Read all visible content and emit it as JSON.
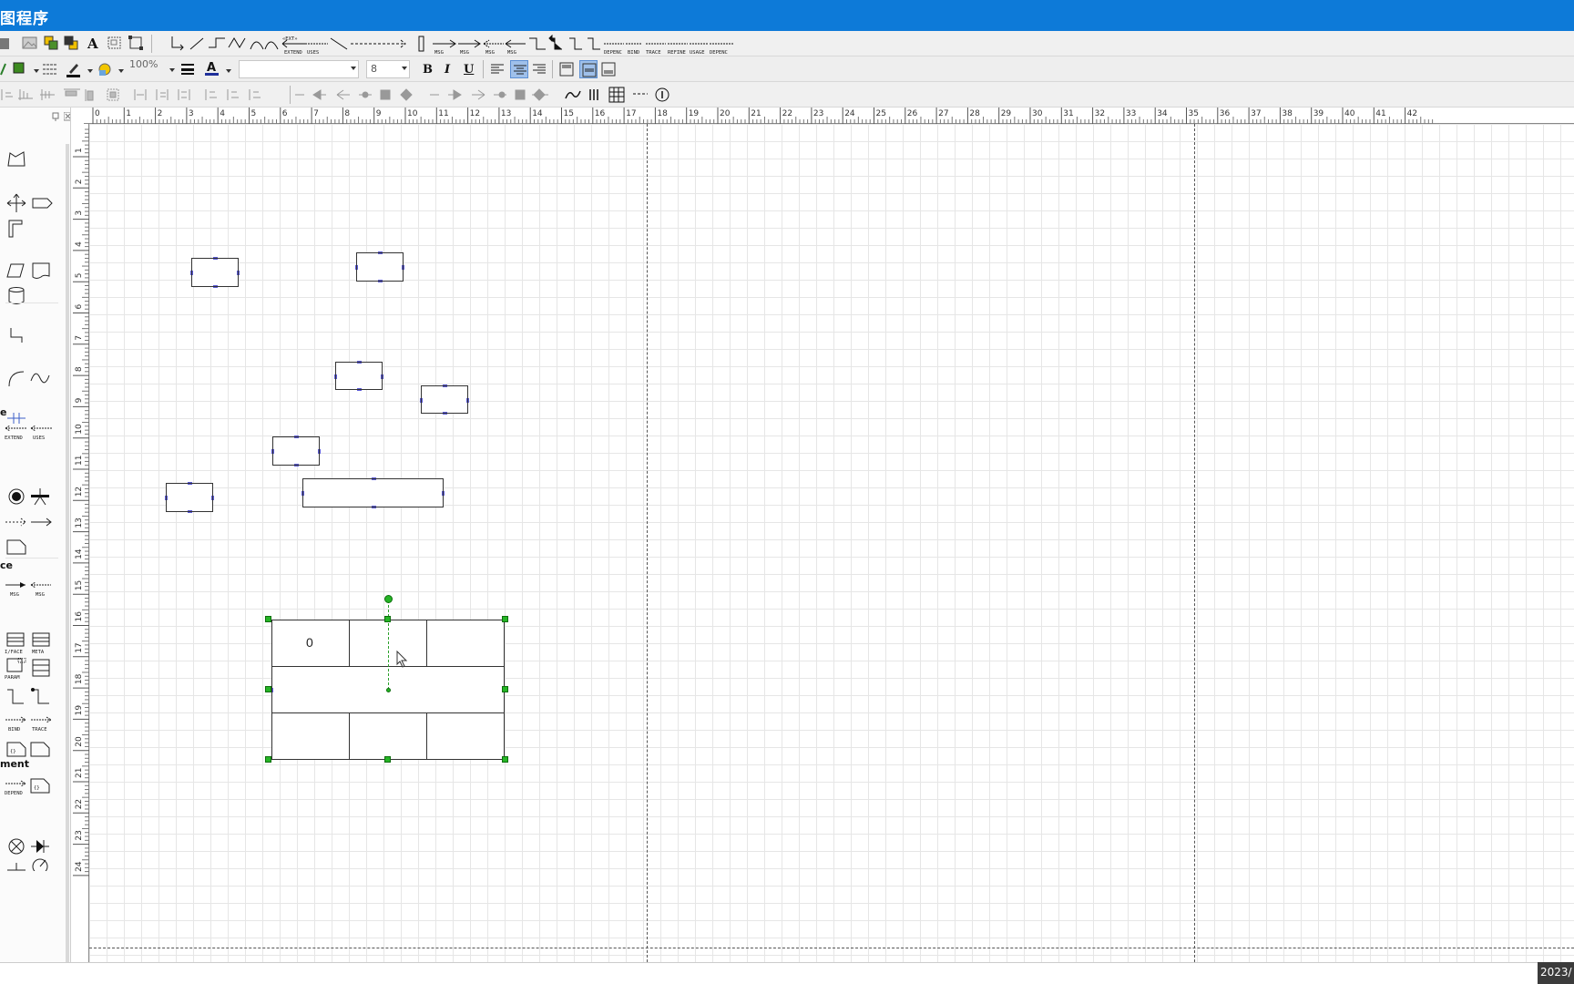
{
  "window": {
    "title": "图程序"
  },
  "toolbar_main": {
    "zoom_value": "100%",
    "connector_labels": [
      "EXTEND",
      "USES",
      "MSG",
      "MSG",
      "MSG",
      "MSG",
      "DEPENC",
      "BIND",
      "TRACE",
      "REFINE",
      "USAGE",
      "DEPENC"
    ]
  },
  "toolbar_format": {
    "font_family_value": "",
    "font_size_value": "8",
    "bold_label": "B",
    "italic_label": "I",
    "underline_label": "U"
  },
  "palette": {
    "headers": [
      "e",
      "ce",
      "ment"
    ],
    "labels": [
      "EXTEND",
      "USES",
      "MSG",
      "MSG",
      "I/FACE",
      "META",
      "PARAM",
      "BIND",
      "TRACE",
      "DEPEND"
    ]
  },
  "ruler": {
    "top_numbers": [
      "0",
      "1",
      "2",
      "3",
      "4",
      "5",
      "6",
      "7",
      "8",
      "9",
      "10",
      "11",
      "12",
      "13",
      "14",
      "15",
      "16",
      "17",
      "18",
      "19",
      "20",
      "21",
      "22",
      "23",
      "24",
      "25",
      "26",
      "27",
      "28",
      "29",
      "30",
      "31",
      "32",
      "33",
      "34",
      "35",
      "36",
      "37",
      "38",
      "39",
      "40",
      "41",
      "42"
    ],
    "left_numbers": [
      "1",
      "2",
      "3",
      "4",
      "5",
      "6",
      "7",
      "8",
      "9",
      "10",
      "11",
      "12",
      "13",
      "14",
      "15",
      "16",
      "17",
      "18",
      "19",
      "20",
      "21",
      "22",
      "23",
      "24"
    ]
  },
  "diagram": {
    "table_cell_text": "0"
  },
  "taskbar": {
    "clock_text": "2023/"
  }
}
